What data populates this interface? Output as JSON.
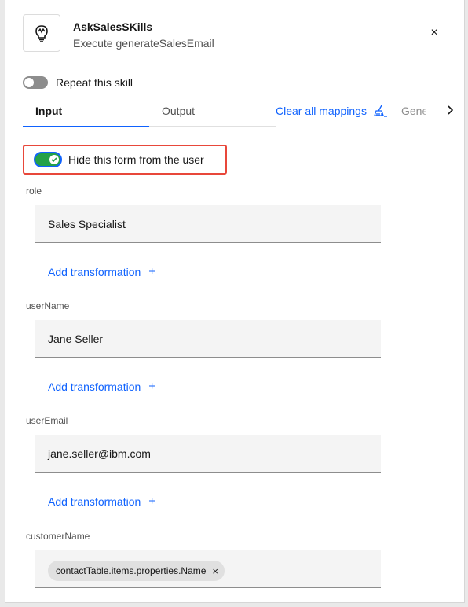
{
  "header": {
    "title": "AskSalesSKills",
    "subtitle": "Execute generateSalesEmail",
    "skill_icon": "lightbulb-icon",
    "close_icon": "close-icon",
    "close_glyph": "×"
  },
  "repeat": {
    "label": "Repeat this skill",
    "enabled": false
  },
  "tabs": {
    "items": [
      {
        "label": "Input",
        "active": true
      },
      {
        "label": "Output",
        "active": false
      }
    ],
    "clear_mappings": "Clear all mappings",
    "clear_icon": "broom-icon",
    "overflow_tab": "Generat",
    "scroll_icon": "chevron-right-icon"
  },
  "hide_form": {
    "label": "Hide this form from the user",
    "enabled": true
  },
  "fields": [
    {
      "label": "role",
      "value": "Sales Specialist",
      "transform": "Add transformation",
      "plus": "+"
    },
    {
      "label": "userName",
      "value": "Jane Seller",
      "transform": "Add transformation",
      "plus": "+"
    },
    {
      "label": "userEmail",
      "value": "jane.seller@ibm.com",
      "transform": "Add transformation",
      "plus": "+"
    },
    {
      "label": "customerName",
      "chip": "contactTable.items.properties.Name",
      "chip_close": "×"
    }
  ],
  "colors": {
    "accent": "#0f62fe",
    "toggle_on": "#24a148",
    "highlight_border": "#e8473a"
  }
}
